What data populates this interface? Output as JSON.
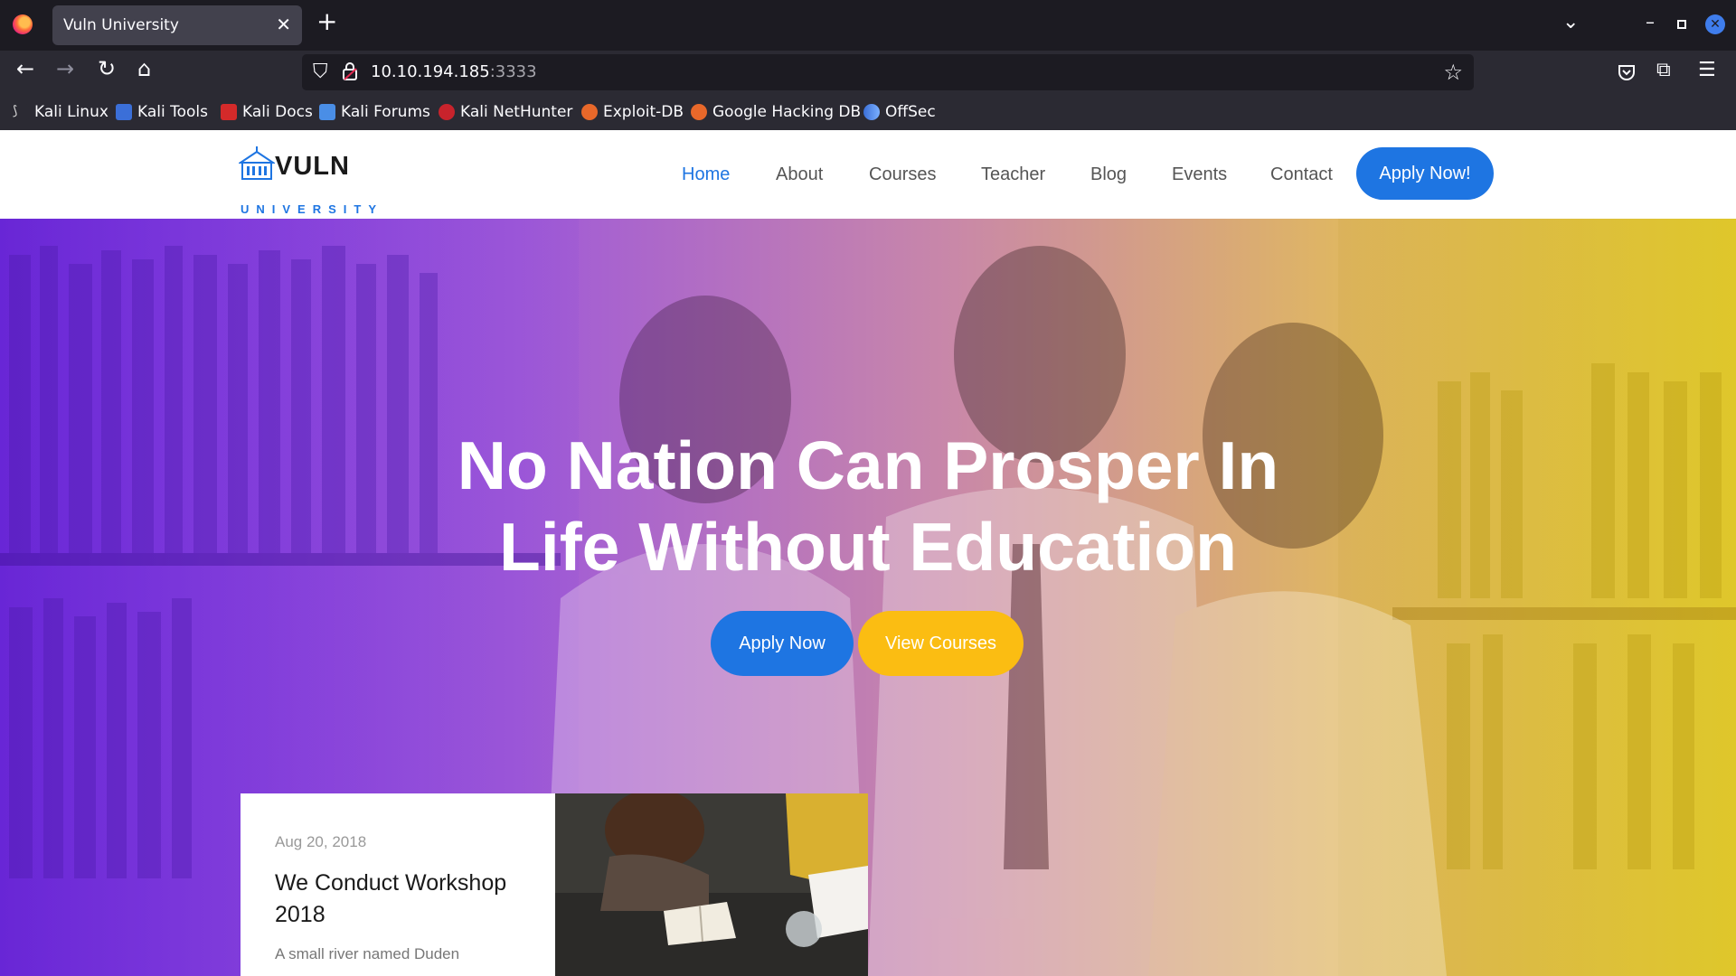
{
  "browser": {
    "tab_title": "Vuln University",
    "tab_close": "✕",
    "new_tab": "+",
    "url_host": "10.10.194.185",
    "url_port": ":3333",
    "icons": [
      "firefox-icon",
      "back-arrow-icon",
      "forward-arrow-icon",
      "reload-icon",
      "home-icon",
      "shield-icon",
      "lock-icon",
      "star-icon",
      "pocket-icon",
      "extensions-icon",
      "hamburger-menu-icon"
    ],
    "bookmarks": [
      "Kali Linux",
      "Kali Tools",
      "Kali Docs",
      "Kali Forums",
      "Kali NetHunter",
      "Exploit-DB",
      "Google Hacking DB",
      "OffSec"
    ]
  },
  "site": {
    "logo_name": "VULN",
    "logo_sub": "UNIVERSITY",
    "menu": [
      "Home",
      "About",
      "Courses",
      "Teacher",
      "Blog",
      "Events",
      "Contact"
    ],
    "active_menu": "Home",
    "apply_cta": "Apply Now!",
    "accent_color": "#1e75e2",
    "secondary_color": "#fbbd12"
  },
  "hero": {
    "title_line1": "No Nation Can Prosper In",
    "title_line2": "Life Without Education",
    "primary_button": "Apply Now",
    "secondary_button": "View Courses"
  },
  "event": {
    "date": "Aug 20, 2018",
    "title": "We Conduct Workshop 2018",
    "excerpt": "A small river named Duden"
  }
}
